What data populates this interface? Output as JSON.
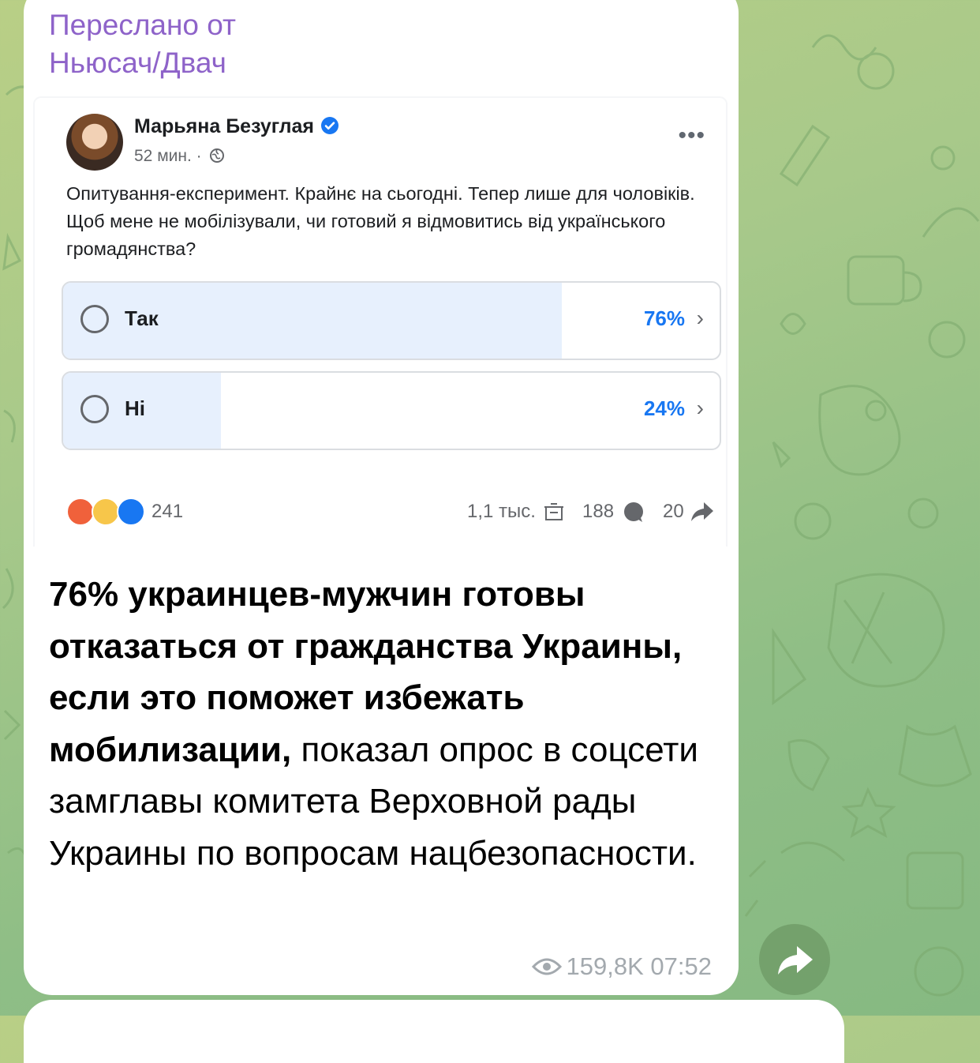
{
  "forward": {
    "line1": "Переслано от",
    "line2": "Ньюсач/Двач"
  },
  "post": {
    "author": "Марьяна Безуглая",
    "time": "52 мин. ·",
    "more": "•••",
    "text": "Опитування-експеримент. Крайнє на сьогодні. Тепер лише для чоловіків. Щоб мене не мобілізували, чи готовий я відмовитись від українського громадянства?",
    "poll": [
      {
        "label": "Так",
        "percent_text": "76%",
        "fraction": 0.76
      },
      {
        "label": "Ні",
        "percent_text": "24%",
        "fraction": 0.24
      }
    ],
    "reactions_count": "241",
    "views": "1,1 тыс.",
    "comments": "188",
    "shares": "20"
  },
  "caption": {
    "bold": "76% украинцев-мужчин готовы отказаться от гражданства Украины, если это поможет избежать мобилизации,",
    "regular": " показал опрос в соцсети замглавы комитета Верховной рады Украины по вопросам нацбезопасности."
  },
  "message_meta": {
    "views": "159,8K",
    "time": "07:52"
  },
  "colors": {
    "forward_header": "#8e63c9",
    "poll_fill": "#e7f0fd",
    "poll_percent": "#1877f2",
    "verified_badge": "#1877f2",
    "wallpaper": "#9cc489"
  },
  "icons": [
    "verified-icon",
    "globe-icon",
    "more-icon",
    "radio-icon",
    "chevron-right-icon",
    "angry-reaction-icon",
    "haha-reaction-icon",
    "like-reaction-icon",
    "views-icon",
    "comment-icon",
    "share-arrow-icon",
    "eye-icon",
    "forward-icon"
  ]
}
